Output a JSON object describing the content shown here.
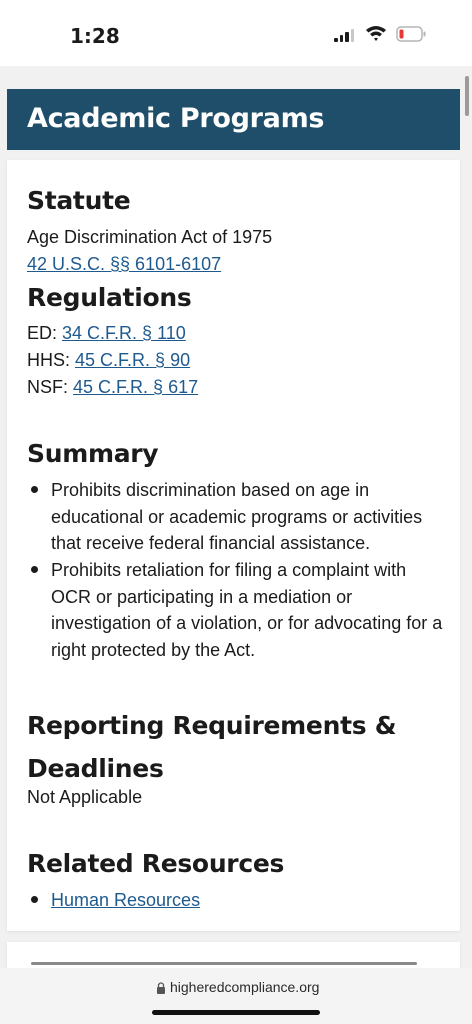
{
  "status_bar": {
    "time": "1:28"
  },
  "page": {
    "title": "Academic Programs",
    "statute": {
      "heading": "Statute",
      "name": "Age Discrimination Act of 1975",
      "citation": "42 U.S.C. §§ 6101-6107"
    },
    "regulations": {
      "heading": "Regulations",
      "items": [
        {
          "agency": "ED:",
          "citation": "34 C.F.R. § 110"
        },
        {
          "agency": "HHS:",
          "citation": "45 C.F.R. § 90"
        },
        {
          "agency": "NSF:",
          "citation": "45 C.F.R. § 617"
        }
      ]
    },
    "summary": {
      "heading": "Summary",
      "items": [
        "Prohibits discrimination based on age in educational or academic programs or activities that receive federal financial assistance.",
        "Prohibits retaliation for filing a complaint with OCR or participating in a mediation or investigation of a violation, or for advocating for a right protected by the Act."
      ]
    },
    "reporting": {
      "heading": "Reporting Requirements & Deadlines",
      "value": "Not Applicable"
    },
    "related": {
      "heading": "Related Resources",
      "items": [
        "Human Resources"
      ]
    }
  },
  "browser": {
    "url": "higheredcompliance.org"
  },
  "colors": {
    "banner": "#1f4e6a",
    "link": "#1f5a8f"
  },
  "icons": {
    "signal": "cellular-signal-icon",
    "wifi": "wifi-icon",
    "battery": "battery-low-icon",
    "lock": "lock-icon"
  }
}
